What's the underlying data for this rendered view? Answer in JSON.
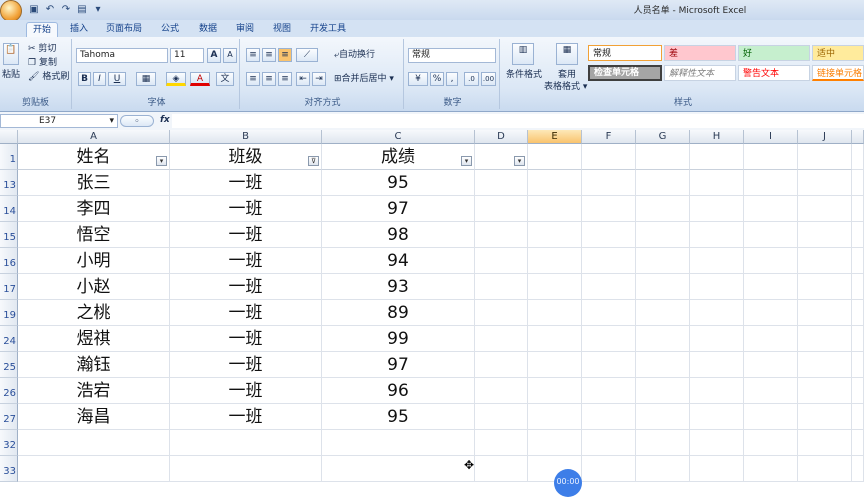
{
  "window": {
    "title": "人员名单 - Microsoft Excel"
  },
  "tabs": [
    "开始",
    "插入",
    "页面布局",
    "公式",
    "数据",
    "审阅",
    "视图",
    "开发工具"
  ],
  "clipboard": {
    "paste": "粘贴",
    "cut": "剪切",
    "copy": "复制",
    "format_painter": "格式刷",
    "label": "剪贴板"
  },
  "font": {
    "name": "Tahoma",
    "size": "11",
    "label": "字体",
    "bold": "B",
    "italic": "I",
    "underline": "U",
    "grow": "A",
    "shrink": "A",
    "font_color": "A"
  },
  "alignment": {
    "wrap": "自动换行",
    "merge": "合并后居中",
    "label": "对齐方式"
  },
  "number": {
    "format": "常规",
    "percent": "%",
    "comma": ",",
    "label": "数字"
  },
  "styles": {
    "conditional": "条件格式",
    "table_format": "套用\n表格格式",
    "table_format_1": "套用",
    "table_format_2": "表格格式",
    "normal": "常规",
    "bad": "差",
    "good": "好",
    "neutral": "适中",
    "check_cell": "检查单元格",
    "explanatory": "解释性文本",
    "warning": "警告文本",
    "linked": "链接单元格",
    "label": "样式",
    "colors": {
      "bad_bg": "#ffc7ce",
      "good_bg": "#c6efce",
      "neutral_bg": "#ffeb9c",
      "check_bg": "#a5a5a5"
    }
  },
  "formula_bar": {
    "name_box": "E37",
    "fx": "fx",
    "content": ""
  },
  "grid": {
    "columns": [
      "A",
      "B",
      "C",
      "D",
      "E",
      "F",
      "G",
      "H",
      "I",
      "J"
    ],
    "selected_column": "E",
    "header_row": {
      "row": "1",
      "cells": [
        "姓名",
        "班级",
        "成绩",
        ""
      ]
    },
    "rows": [
      {
        "row": "13",
        "cells": [
          "张三",
          "一班",
          "95"
        ]
      },
      {
        "row": "14",
        "cells": [
          "李四",
          "一班",
          "97"
        ]
      },
      {
        "row": "15",
        "cells": [
          "悟空",
          "一班",
          "98"
        ]
      },
      {
        "row": "16",
        "cells": [
          "小明",
          "一班",
          "94"
        ]
      },
      {
        "row": "17",
        "cells": [
          "小赵",
          "一班",
          "93"
        ]
      },
      {
        "row": "19",
        "cells": [
          "之桃",
          "一班",
          "89"
        ]
      },
      {
        "row": "24",
        "cells": [
          "煜祺",
          "一班",
          "99"
        ]
      },
      {
        "row": "25",
        "cells": [
          "瀚钰",
          "一班",
          "97"
        ]
      },
      {
        "row": "26",
        "cells": [
          "浩宕",
          "一班",
          "96"
        ]
      },
      {
        "row": "27",
        "cells": [
          "海昌",
          "一班",
          "95"
        ]
      },
      {
        "row": "32",
        "cells": [
          "",
          "",
          ""
        ]
      },
      {
        "row": "33",
        "cells": [
          "",
          "",
          ""
        ]
      }
    ]
  },
  "overlay": {
    "timer": "00:00"
  }
}
